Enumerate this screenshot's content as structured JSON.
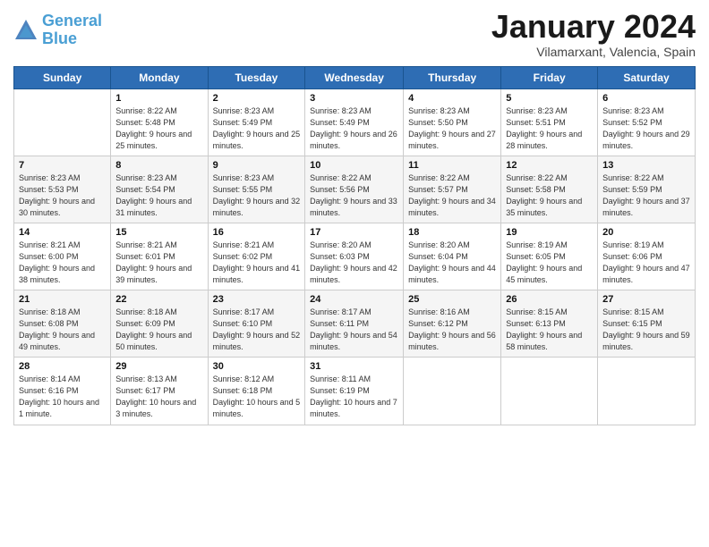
{
  "app": {
    "name": "GeneralBlue",
    "logo_line1": "General",
    "logo_line2": "Blue"
  },
  "calendar": {
    "month": "January 2024",
    "location": "Vilamarxant, Valencia, Spain",
    "headers": [
      "Sunday",
      "Monday",
      "Tuesday",
      "Wednesday",
      "Thursday",
      "Friday",
      "Saturday"
    ],
    "weeks": [
      [
        {
          "day": "",
          "sunrise": "",
          "sunset": "",
          "daylight": ""
        },
        {
          "day": "1",
          "sunrise": "Sunrise: 8:22 AM",
          "sunset": "Sunset: 5:48 PM",
          "daylight": "Daylight: 9 hours and 25 minutes."
        },
        {
          "day": "2",
          "sunrise": "Sunrise: 8:23 AM",
          "sunset": "Sunset: 5:49 PM",
          "daylight": "Daylight: 9 hours and 25 minutes."
        },
        {
          "day": "3",
          "sunrise": "Sunrise: 8:23 AM",
          "sunset": "Sunset: 5:49 PM",
          "daylight": "Daylight: 9 hours and 26 minutes."
        },
        {
          "day": "4",
          "sunrise": "Sunrise: 8:23 AM",
          "sunset": "Sunset: 5:50 PM",
          "daylight": "Daylight: 9 hours and 27 minutes."
        },
        {
          "day": "5",
          "sunrise": "Sunrise: 8:23 AM",
          "sunset": "Sunset: 5:51 PM",
          "daylight": "Daylight: 9 hours and 28 minutes."
        },
        {
          "day": "6",
          "sunrise": "Sunrise: 8:23 AM",
          "sunset": "Sunset: 5:52 PM",
          "daylight": "Daylight: 9 hours and 29 minutes."
        }
      ],
      [
        {
          "day": "7",
          "sunrise": "Sunrise: 8:23 AM",
          "sunset": "Sunset: 5:53 PM",
          "daylight": "Daylight: 9 hours and 30 minutes."
        },
        {
          "day": "8",
          "sunrise": "Sunrise: 8:23 AM",
          "sunset": "Sunset: 5:54 PM",
          "daylight": "Daylight: 9 hours and 31 minutes."
        },
        {
          "day": "9",
          "sunrise": "Sunrise: 8:23 AM",
          "sunset": "Sunset: 5:55 PM",
          "daylight": "Daylight: 9 hours and 32 minutes."
        },
        {
          "day": "10",
          "sunrise": "Sunrise: 8:22 AM",
          "sunset": "Sunset: 5:56 PM",
          "daylight": "Daylight: 9 hours and 33 minutes."
        },
        {
          "day": "11",
          "sunrise": "Sunrise: 8:22 AM",
          "sunset": "Sunset: 5:57 PM",
          "daylight": "Daylight: 9 hours and 34 minutes."
        },
        {
          "day": "12",
          "sunrise": "Sunrise: 8:22 AM",
          "sunset": "Sunset: 5:58 PM",
          "daylight": "Daylight: 9 hours and 35 minutes."
        },
        {
          "day": "13",
          "sunrise": "Sunrise: 8:22 AM",
          "sunset": "Sunset: 5:59 PM",
          "daylight": "Daylight: 9 hours and 37 minutes."
        }
      ],
      [
        {
          "day": "14",
          "sunrise": "Sunrise: 8:21 AM",
          "sunset": "Sunset: 6:00 PM",
          "daylight": "Daylight: 9 hours and 38 minutes."
        },
        {
          "day": "15",
          "sunrise": "Sunrise: 8:21 AM",
          "sunset": "Sunset: 6:01 PM",
          "daylight": "Daylight: 9 hours and 39 minutes."
        },
        {
          "day": "16",
          "sunrise": "Sunrise: 8:21 AM",
          "sunset": "Sunset: 6:02 PM",
          "daylight": "Daylight: 9 hours and 41 minutes."
        },
        {
          "day": "17",
          "sunrise": "Sunrise: 8:20 AM",
          "sunset": "Sunset: 6:03 PM",
          "daylight": "Daylight: 9 hours and 42 minutes."
        },
        {
          "day": "18",
          "sunrise": "Sunrise: 8:20 AM",
          "sunset": "Sunset: 6:04 PM",
          "daylight": "Daylight: 9 hours and 44 minutes."
        },
        {
          "day": "19",
          "sunrise": "Sunrise: 8:19 AM",
          "sunset": "Sunset: 6:05 PM",
          "daylight": "Daylight: 9 hours and 45 minutes."
        },
        {
          "day": "20",
          "sunrise": "Sunrise: 8:19 AM",
          "sunset": "Sunset: 6:06 PM",
          "daylight": "Daylight: 9 hours and 47 minutes."
        }
      ],
      [
        {
          "day": "21",
          "sunrise": "Sunrise: 8:18 AM",
          "sunset": "Sunset: 6:08 PM",
          "daylight": "Daylight: 9 hours and 49 minutes."
        },
        {
          "day": "22",
          "sunrise": "Sunrise: 8:18 AM",
          "sunset": "Sunset: 6:09 PM",
          "daylight": "Daylight: 9 hours and 50 minutes."
        },
        {
          "day": "23",
          "sunrise": "Sunrise: 8:17 AM",
          "sunset": "Sunset: 6:10 PM",
          "daylight": "Daylight: 9 hours and 52 minutes."
        },
        {
          "day": "24",
          "sunrise": "Sunrise: 8:17 AM",
          "sunset": "Sunset: 6:11 PM",
          "daylight": "Daylight: 9 hours and 54 minutes."
        },
        {
          "day": "25",
          "sunrise": "Sunrise: 8:16 AM",
          "sunset": "Sunset: 6:12 PM",
          "daylight": "Daylight: 9 hours and 56 minutes."
        },
        {
          "day": "26",
          "sunrise": "Sunrise: 8:15 AM",
          "sunset": "Sunset: 6:13 PM",
          "daylight": "Daylight: 9 hours and 58 minutes."
        },
        {
          "day": "27",
          "sunrise": "Sunrise: 8:15 AM",
          "sunset": "Sunset: 6:15 PM",
          "daylight": "Daylight: 9 hours and 59 minutes."
        }
      ],
      [
        {
          "day": "28",
          "sunrise": "Sunrise: 8:14 AM",
          "sunset": "Sunset: 6:16 PM",
          "daylight": "Daylight: 10 hours and 1 minute."
        },
        {
          "day": "29",
          "sunrise": "Sunrise: 8:13 AM",
          "sunset": "Sunset: 6:17 PM",
          "daylight": "Daylight: 10 hours and 3 minutes."
        },
        {
          "day": "30",
          "sunrise": "Sunrise: 8:12 AM",
          "sunset": "Sunset: 6:18 PM",
          "daylight": "Daylight: 10 hours and 5 minutes."
        },
        {
          "day": "31",
          "sunrise": "Sunrise: 8:11 AM",
          "sunset": "Sunset: 6:19 PM",
          "daylight": "Daylight: 10 hours and 7 minutes."
        },
        {
          "day": "",
          "sunrise": "",
          "sunset": "",
          "daylight": ""
        },
        {
          "day": "",
          "sunrise": "",
          "sunset": "",
          "daylight": ""
        },
        {
          "day": "",
          "sunrise": "",
          "sunset": "",
          "daylight": ""
        }
      ]
    ]
  }
}
